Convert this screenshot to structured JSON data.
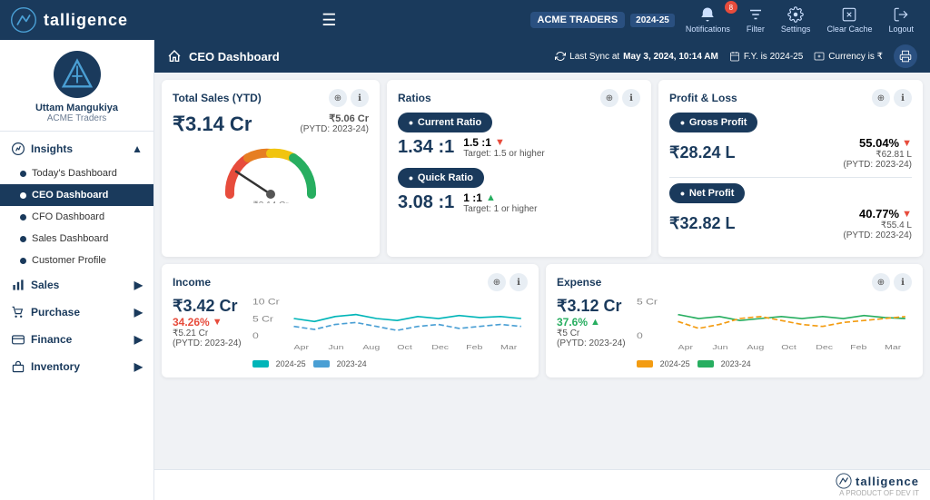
{
  "brand": {
    "name": "talligence",
    "tagline": "A PRODUCT OF DEV IT"
  },
  "navbar": {
    "company": "ACME TRADERS",
    "fy": "2024-25",
    "notifications_count": "8",
    "buttons": [
      "Notifications",
      "Filter",
      "Settings",
      "Clear Cache",
      "Logout"
    ]
  },
  "sidebar": {
    "profile_name": "Uttam Mangukiya",
    "profile_company": "ACME Traders",
    "sections": [
      {
        "label": "Insights",
        "icon": "insights-icon",
        "expanded": true,
        "items": [
          {
            "label": "Today's Dashboard",
            "active": false
          },
          {
            "label": "CEO Dashboard",
            "active": true
          },
          {
            "label": "CFO Dashboard",
            "active": false
          },
          {
            "label": "Sales Dashboard",
            "active": false
          },
          {
            "label": "Customer Profile",
            "active": false
          }
        ]
      },
      {
        "label": "Sales",
        "icon": "sales-icon",
        "expanded": false,
        "items": []
      },
      {
        "label": "Purchase",
        "icon": "purchase-icon",
        "expanded": false,
        "items": []
      },
      {
        "label": "Finance",
        "icon": "finance-icon",
        "expanded": false,
        "items": []
      },
      {
        "label": "Inventory",
        "icon": "inventory-icon",
        "expanded": false,
        "items": []
      }
    ]
  },
  "header": {
    "title": "CEO Dashboard",
    "sync_label": "Last Sync at",
    "sync_time": "May 3, 2024, 10:14 AM",
    "fy_label": "F.Y. is 2024-25",
    "currency_label": "Currency is ₹"
  },
  "total_sales": {
    "title": "Total Sales (YTD)",
    "value": "₹3.14 Cr",
    "prev_value": "₹5.06 Cr",
    "prev_label": "(PYTD: 2023-24)"
  },
  "ratios": {
    "title": "Ratios",
    "current_ratio": {
      "label": "Current Ratio",
      "value": "1.34 :1",
      "target_val": "1.5 :1",
      "target_label": "Target: 1.5 or higher",
      "trend": "down"
    },
    "quick_ratio": {
      "label": "Quick Ratio",
      "value": "3.08 :1",
      "target_val": "1 :1",
      "target_label": "Target: 1 or higher",
      "trend": "up"
    }
  },
  "pnl": {
    "title": "Profit & Loss",
    "gross_profit": {
      "label": "Gross Profit",
      "value": "₹28.24 L",
      "pct": "55.04%",
      "prev_value": "₹62.81 L",
      "prev_label": "(PYTD: 2023-24)",
      "trend": "down"
    },
    "net_profit": {
      "label": "Net Profit",
      "value": "₹32.82 L",
      "pct": "40.77%",
      "prev_value": "₹55.4 L",
      "prev_label": "(PYTD: 2023-24)",
      "trend": "down"
    }
  },
  "income": {
    "title": "Income",
    "value": "₹3.42 Cr",
    "pct": "34.26%",
    "prev_value": "₹5.21 Cr",
    "prev_label": "(PYTD: 2023-24)",
    "trend": "down",
    "legend_2425": "2024-25",
    "legend_2324": "2023-24"
  },
  "expense": {
    "title": "Expense",
    "value": "₹3.12 Cr",
    "pct": "37.6%",
    "prev_value": "₹5 Cr",
    "prev_label": "(PYTD: 2023-24)",
    "trend": "up",
    "legend_2425": "2024-25",
    "legend_2324": "2023-24"
  },
  "colors": {
    "primary": "#1a3a5c",
    "accent": "#27ae60",
    "danger": "#e74c3c",
    "teal": "#00b5b8",
    "orange": "#f39c12"
  }
}
